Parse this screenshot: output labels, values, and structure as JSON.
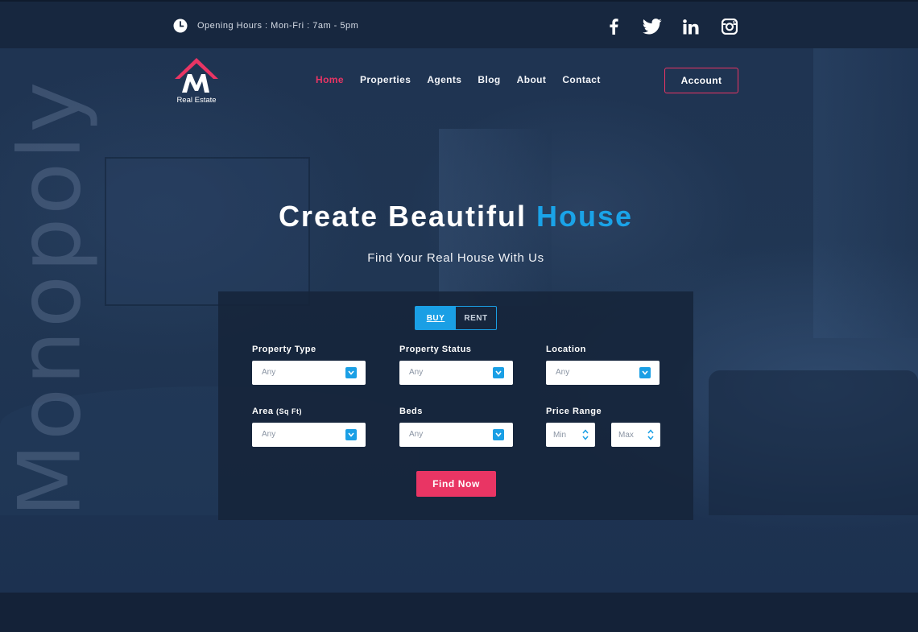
{
  "topbar": {
    "hours": "Opening Hours : Mon-Fri : 7am - 5pm",
    "icons": [
      "clock-icon",
      "facebook-icon",
      "twitter-icon",
      "linkedin-icon",
      "instagram-icon"
    ]
  },
  "logo": {
    "letter": "M",
    "text": "Real Estate"
  },
  "nav": {
    "items": [
      {
        "label": "Home"
      },
      {
        "label": "Properties"
      },
      {
        "label": "Agents"
      },
      {
        "label": "Blog"
      },
      {
        "label": "About"
      },
      {
        "label": "Contact"
      }
    ],
    "active": "Home",
    "account_label": "Account"
  },
  "hero": {
    "watermark": "Monopoly",
    "title_main": "Create Beautiful",
    "title_highlight": "House",
    "subtitle": "Find Your Real House With Us"
  },
  "search": {
    "toggle": {
      "buy": "BUY",
      "rent": "RENT",
      "selected": "BUY"
    },
    "fields": {
      "property_type": {
        "label": "Property Type",
        "value": "Any"
      },
      "property_status": {
        "label": "Property Status",
        "value": "Any"
      },
      "location": {
        "label": "Location",
        "value": "Any"
      },
      "area": {
        "label": "Area",
        "unit": "(Sq Ft)",
        "value": "Any"
      },
      "beds": {
        "label": "Beds",
        "value": "Any"
      },
      "price_range": {
        "label": "Price Range",
        "min_placeholder": "Min",
        "max_placeholder": "Max"
      }
    },
    "submit_label": "Find Now"
  },
  "colors": {
    "accent_pink": "#e93564",
    "accent_blue": "#1aa3e8",
    "topbar_bg": "#17273f",
    "panel_bg": "#16243a"
  }
}
